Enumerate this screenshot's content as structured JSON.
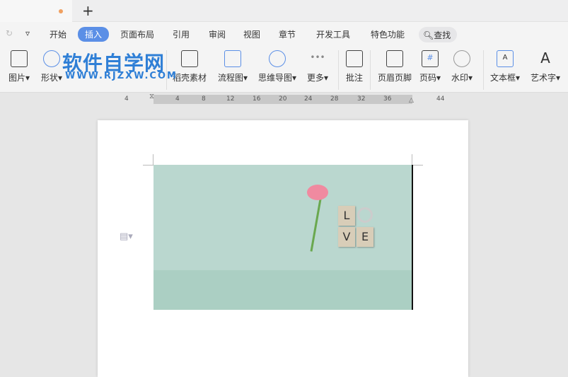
{
  "tabbar": {
    "new_tab": "+"
  },
  "menu": {
    "items": [
      "开始",
      "插入",
      "页面布局",
      "引用",
      "审阅",
      "视图",
      "章节",
      "开发工具",
      "特色功能"
    ],
    "active": "插入",
    "search": "查找"
  },
  "ribbon": {
    "items": [
      "图片",
      "形状",
      "稻壳素材",
      "流程图",
      "思维导图",
      "更多",
      "批注",
      "页眉页脚",
      "页码",
      "水印",
      "文本框",
      "艺术字"
    ]
  },
  "watermark": {
    "title": "软件自学网",
    "url": "WWW.RJZXW.COM"
  },
  "ruler": {
    "ticks": [
      "4",
      "4",
      "8",
      "12",
      "16",
      "20",
      "24",
      "28",
      "32",
      "36",
      "44"
    ]
  },
  "image": {
    "tiles": [
      "L",
      "V",
      "E"
    ]
  }
}
